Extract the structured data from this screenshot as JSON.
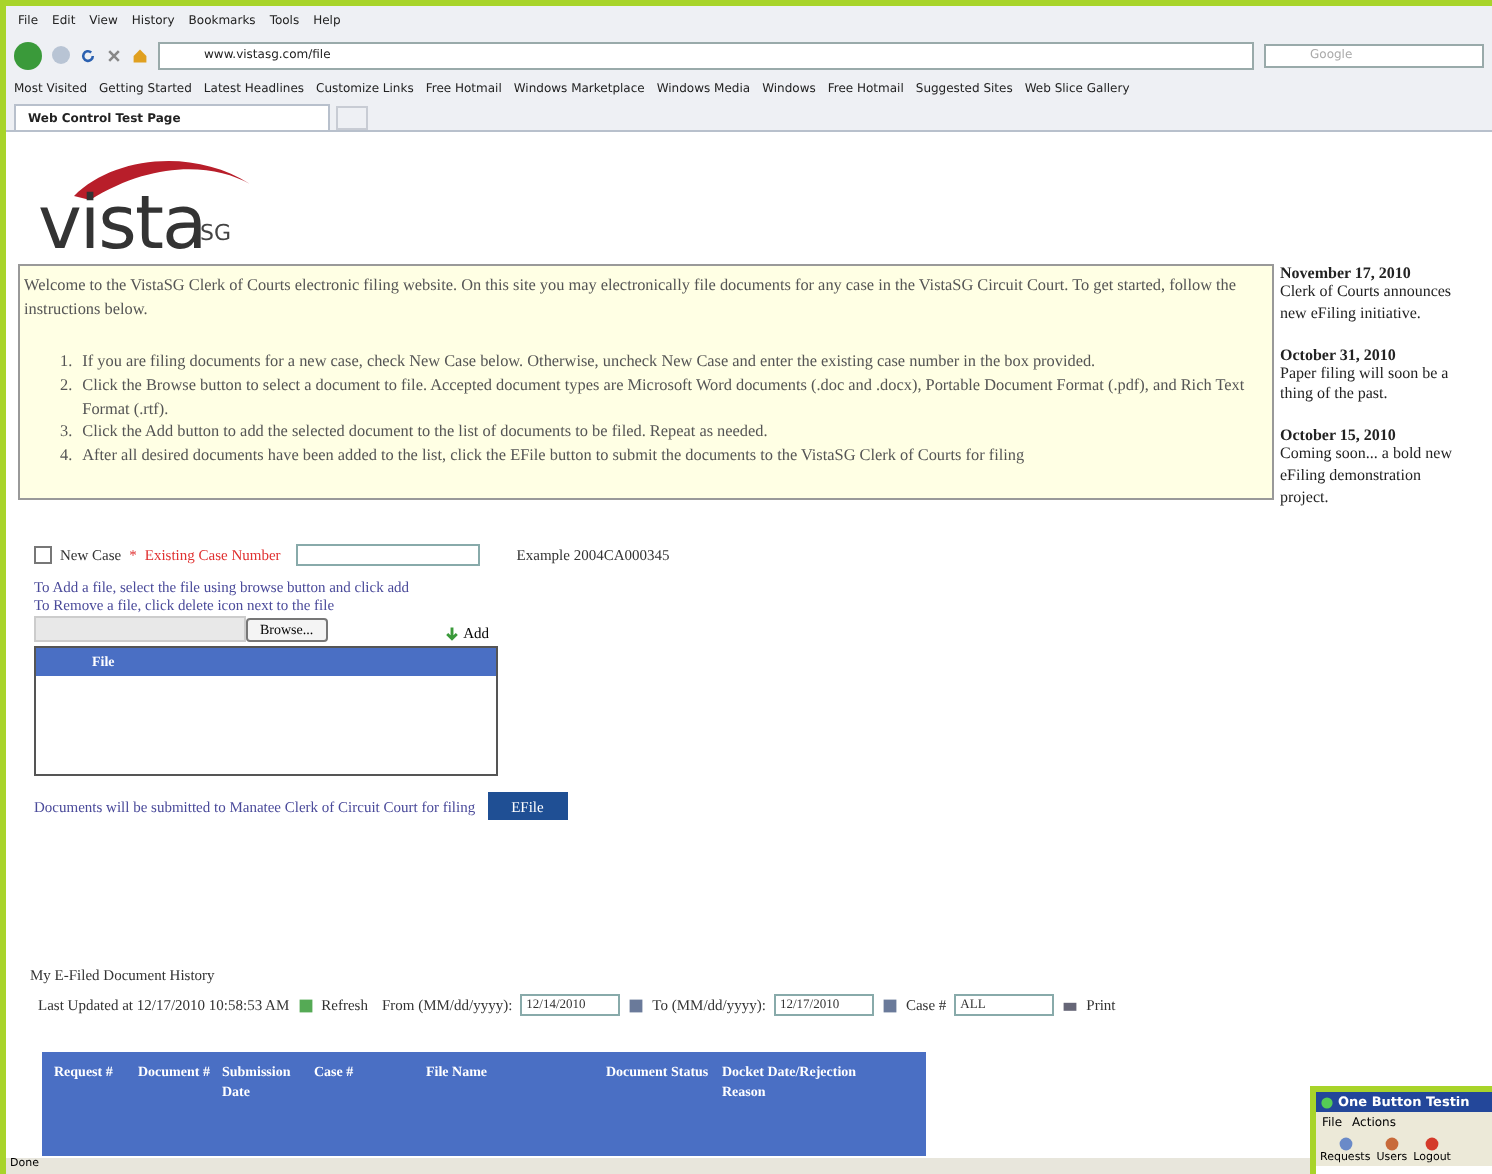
{
  "browser": {
    "menu": [
      "File",
      "Edit",
      "View",
      "History",
      "Bookmarks",
      "Tools",
      "Help"
    ],
    "url": "www.vistasg.com/file",
    "search_placeholder": "Google",
    "bookmarks": [
      "Most Visited",
      "Getting Started",
      "Latest Headlines",
      "Customize Links",
      "Free Hotmail",
      "Windows Marketplace",
      "Windows Media",
      "Windows",
      "Free Hotmail",
      "Suggested Sites",
      "Web Slice Gallery"
    ],
    "tab": "Web Control Test Page"
  },
  "logo": {
    "name": "vista",
    "suffix": "SG"
  },
  "welcome": {
    "intro": "Welcome to the VistaSG Clerk of Courts electronic filing website. On this site you may electronically file documents for any case in the VistaSG Circuit Court. To get started, follow the instructions below.",
    "steps": [
      {
        "number": "1.",
        "text": "If you are filing documents for a new case, check New Case below. Otherwise, uncheck New Case and enter the existing case number in the box provided."
      },
      {
        "number": "2.",
        "text": "Click the Browse button to select a document to file. Accepted document types are Microsoft Word documents (.doc and .docx), Portable Document Format (.pdf), and Rich Text Format (.rtf)."
      },
      {
        "number": "3.",
        "text": "Click the Add button to add the selected document to the list of documents to be filed. Repeat as needed."
      },
      {
        "number": "4.",
        "text": "After all desired documents have been added to the list, click the EFile button to submit the documents to the VistaSG Clerk of Courts for filing"
      }
    ]
  },
  "news": [
    {
      "date": "November 17, 2010",
      "text": "Clerk of Courts announces new eFiling initiative."
    },
    {
      "date": "October 31, 2010",
      "text": "Paper filing will soon be a thing of the past."
    },
    {
      "date": "October 15, 2010",
      "text": "Coming soon... a bold new eFiling demonstration project."
    }
  ],
  "form": {
    "new_case": {
      "label": "New Case",
      "checked": false
    },
    "required_mark": "*",
    "existing_label": "Existing Case Number",
    "example": "Example 2004CA000345",
    "hints": [
      "To Add a file, select the file using browse button and click add",
      "To Remove a file, click delete icon next to the file"
    ],
    "browse": "Browse...",
    "add": "Add",
    "file_header": "File",
    "submit_note": "Documents will be submitted to Manatee Clerk of Circuit Court for filing",
    "efile": "EFile"
  },
  "history": {
    "title": "My E-Filed Document History",
    "last_updated": "Last Updated at 12/17/2010 10:58:53 AM",
    "refresh": "Refresh",
    "from_label": "From (MM/dd/yyyy):",
    "from_value": "12/14/2010",
    "to_label": "To (MM/dd/yyyy):",
    "to_value": "12/17/2010",
    "case_label": "Case #",
    "case_value": "ALL",
    "print": "Print",
    "columns": [
      "Request #",
      "Document #",
      "Submission Date",
      "Case #",
      "File Name",
      "Document Status",
      "Docket Date/Rejection Reason"
    ]
  },
  "status_bar": "Done",
  "overlay": {
    "title": "One Button Testin",
    "menu": [
      "File",
      "Actions"
    ],
    "tools": [
      "Requests",
      "Users",
      "Logout"
    ]
  }
}
